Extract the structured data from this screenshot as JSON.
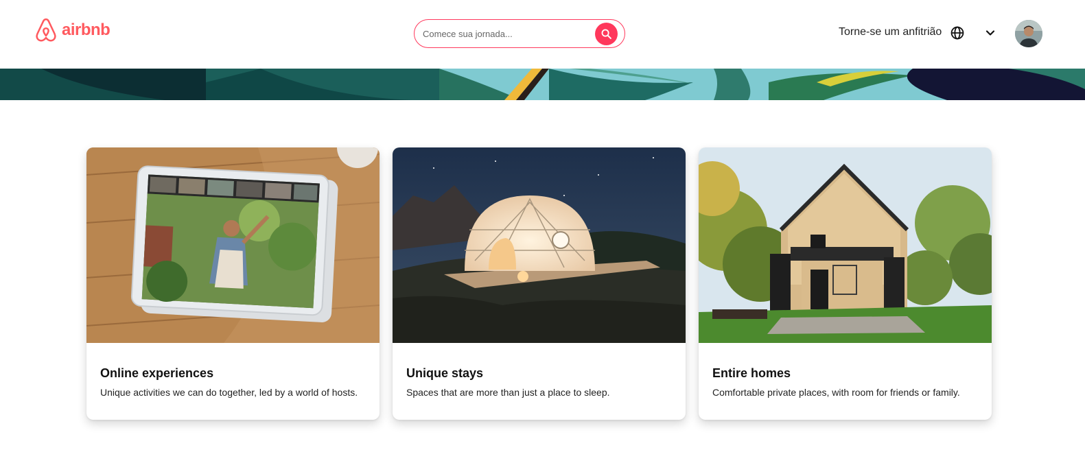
{
  "header": {
    "logo_text": "airbnb",
    "search_placeholder": "Comece sua jornada...",
    "host_link": "Torne-se um anfitrião"
  },
  "colors": {
    "brand": "#ff5a5f",
    "search_accent": "#ff385c"
  },
  "icons": {
    "logo": "airbnb-belo-icon",
    "search": "search-icon",
    "language": "globe-icon",
    "menu": "chevron-down-icon"
  },
  "cards": [
    {
      "title": "Online experiences",
      "description": "Unique activities we can do together, led by a world of hosts."
    },
    {
      "title": "Unique stays",
      "description": "Spaces that are more than just a place to sleep."
    },
    {
      "title": "Entire homes",
      "description": "Comfortable private places, with room for friends or family."
    }
  ]
}
